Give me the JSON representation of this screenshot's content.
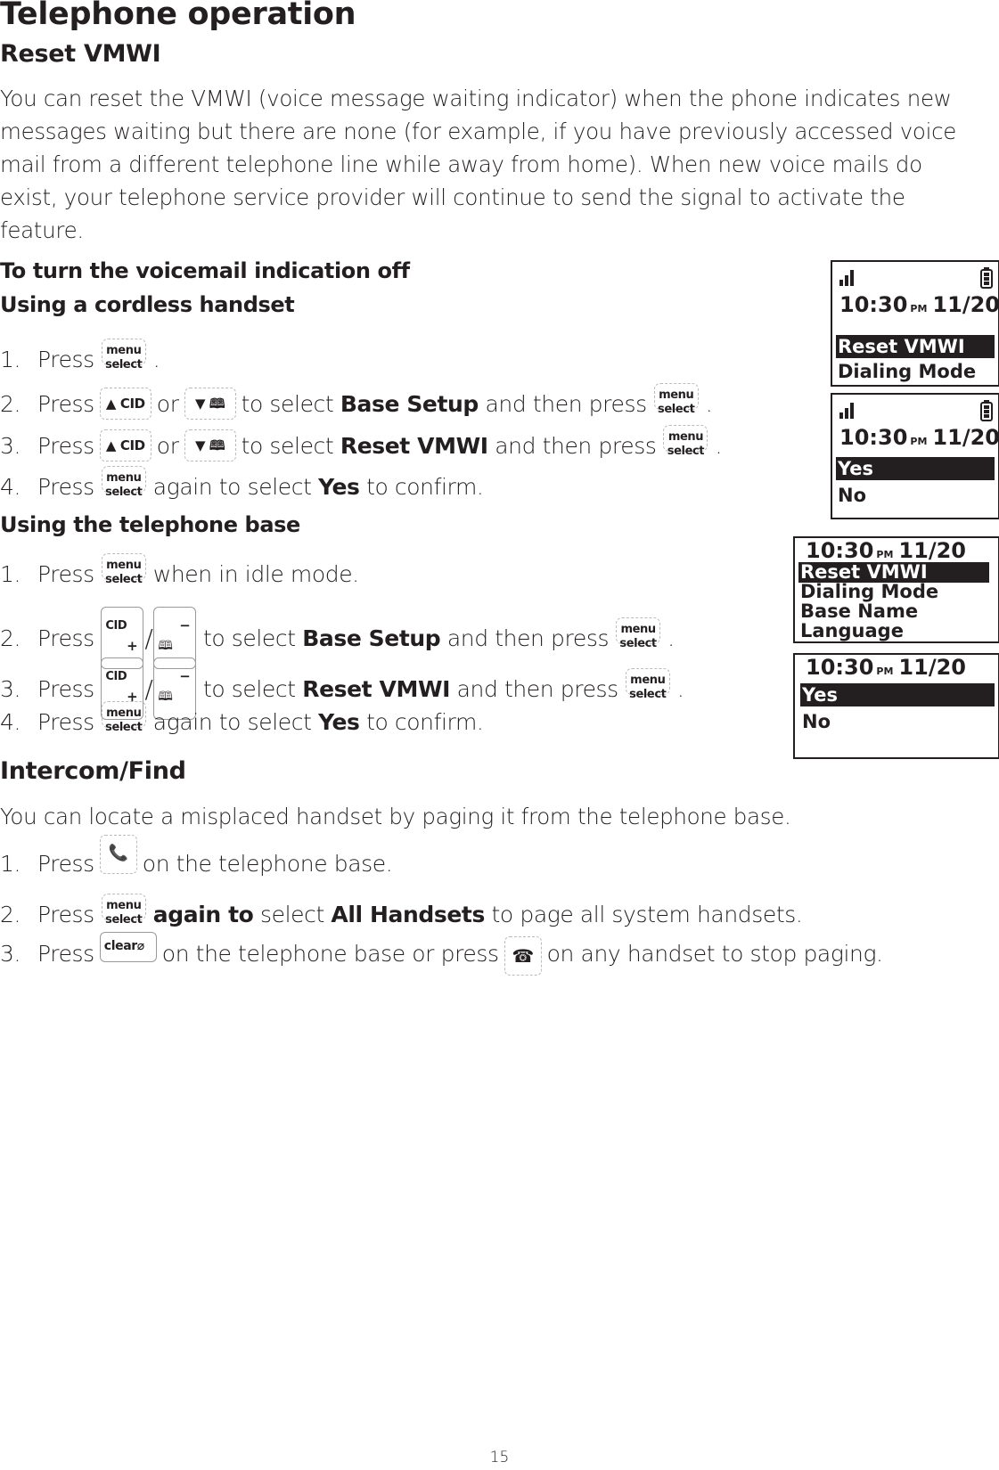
{
  "page_title": "Telephone operation",
  "reset_vmwi": {
    "heading": "Reset VMWI",
    "intro": "You can reset the VMWI (voice message waiting indicator) when the phone indicates new messages waiting but there are none (for example, if you have previously accessed voice mail from a different telephone line while away from home). When new voice mails do exist, your telephone service provider will continue to send the signal to activate the feature.",
    "subheading": "To turn the voicemail indication off",
    "handset": {
      "heading": "Using a cordless handset",
      "steps": [
        {
          "num": "1.",
          "press": "Press",
          "after": "."
        },
        {
          "num": "2.",
          "press": "Press",
          "or": "or",
          "mid": "to select",
          "bold": "Base Setup",
          "tail": "and then press",
          "end": "."
        },
        {
          "num": "3.",
          "press": "Press",
          "or": "or",
          "mid": "to select",
          "bold": "Reset VMWI",
          "tail": "and then press",
          "end": "."
        },
        {
          "num": "4.",
          "press": "Press",
          "mid": "again to select",
          "bold": "Yes",
          "tail": "to confirm."
        }
      ]
    },
    "base": {
      "heading": "Using the telephone base",
      "steps": [
        {
          "num": "1.",
          "press": "Press",
          "tail": "when in idle mode."
        },
        {
          "num": "2.",
          "press": "Press",
          "mid": "to select",
          "bold": "Base Setup",
          "tail": "and then press",
          "end": "."
        },
        {
          "num": "3.",
          "press": "Press",
          "mid": "to select",
          "bold": "Reset VMWI",
          "tail": "and then press",
          "end": "."
        },
        {
          "num": "4.",
          "press": "Press",
          "mid": "again to select",
          "bold": "Yes",
          "tail": "to confirm."
        }
      ]
    }
  },
  "keys": {
    "menu_top": "menu",
    "menu_bottom": "select",
    "cid": "CID",
    "plus": "+",
    "minus": "−",
    "slash": "/",
    "clear": "clear",
    "up_cid_icon": "▲",
    "down_icon": "▼",
    "book_icon": "🕮",
    "find_icon": "♪",
    "mute_icon": "✖",
    "offhook_icon": "☎"
  },
  "intercom": {
    "heading": "Intercom/Find",
    "intro": "You can locate a misplaced handset by paging it from the telephone base.",
    "steps": [
      {
        "num": "1.",
        "press": "Press",
        "tail": "on the telephone base."
      },
      {
        "num": "2.",
        "press": "Press",
        "bold1": "again to",
        "mid": "select",
        "bold2": "All Handsets",
        "tail": "to page all system handsets."
      },
      {
        "num": "3.",
        "press": "Press",
        "mid": "on the telephone base or press",
        "tail": "on any handset to stop paging."
      }
    ]
  },
  "screens": {
    "handset_menu": {
      "time": "10:30",
      "ampm": "PM",
      "date": "11/20",
      "rows": [
        "Reset VMWI",
        "Dialing Mode"
      ],
      "selected": 0
    },
    "handset_confirm": {
      "time": "10:30",
      "ampm": "PM",
      "date": "11/20",
      "rows": [
        "Yes",
        "No"
      ],
      "selected": 0
    },
    "base_menu": {
      "time": "10:30",
      "ampm": "PM",
      "date": "11/20",
      "rows": [
        "Reset VMWI",
        "Dialing Mode",
        "Base Name",
        "Language"
      ],
      "selected": 0
    },
    "base_confirm": {
      "time": "10:30",
      "ampm": "PM",
      "date": "11/20",
      "rows": [
        "Yes",
        "No"
      ],
      "selected": 0
    }
  },
  "page_number": "15"
}
